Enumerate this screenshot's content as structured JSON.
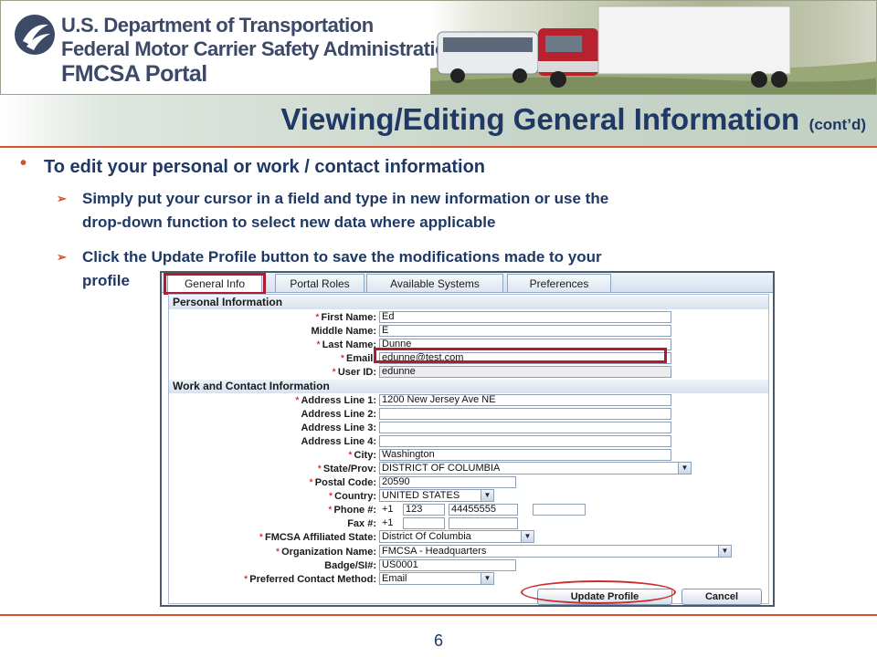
{
  "banner": {
    "dept": "U.S. Department of Transportation",
    "agency": "Federal Motor Carrier Safety Administration",
    "portal": "FMCSA Portal"
  },
  "slide": {
    "title": "Viewing/Editing General Information",
    "title_suffix": "(cont’d)",
    "bullet": "To edit your personal or work / contact information",
    "sub1_line1": "Simply put your cursor in a field and type in new information or use the",
    "sub1_line2": "drop-down function to select new data where applicable",
    "sub2_line1": "Click the Update Profile button to save the modifications made to your",
    "sub2_line2": "profile",
    "page_number": "6"
  },
  "tabs": [
    "General Info",
    "Portal Roles",
    "Available Systems",
    "Preferences"
  ],
  "sections": {
    "personal": "Personal Information",
    "work": "Work and Contact Information"
  },
  "labels": {
    "first_name": "First Name:",
    "middle_name": "Middle Name:",
    "last_name": "Last Name:",
    "email": "Email:",
    "user_id": "User ID:",
    "address1": "Address Line 1:",
    "address2": "Address Line 2:",
    "address3": "Address Line 3:",
    "address4": "Address Line 4:",
    "city": "City:",
    "state": "State/Prov:",
    "postal": "Postal Code:",
    "country": "Country:",
    "phone": "Phone #:",
    "fax": "Fax #:",
    "affiliated_state": "FMCSA Affiliated State:",
    "org": "Organization Name:",
    "badge": "Badge/SI#:",
    "contact_method": "Preferred Contact Method:"
  },
  "values": {
    "first_name": "Ed",
    "middle_name": "E",
    "last_name": "Dunne",
    "email": "edunne@test.com",
    "user_id": "edunne",
    "address1": "1200 New Jersey Ave NE",
    "address2": "",
    "address3": "",
    "address4": "",
    "city": "Washington",
    "state": "DISTRICT OF COLUMBIA",
    "postal": "20590",
    "country": "UNITED STATES",
    "phone_prefix": "+1",
    "phone_area": "123",
    "phone_number": "44455555",
    "phone_ext": "",
    "fax_prefix": "+1",
    "fax_area": "",
    "fax_number": "",
    "affiliated_state": "District Of Columbia",
    "org": "FMCSA - Headquarters",
    "badge": "US0001",
    "contact_method": "Email"
  },
  "buttons": {
    "update": "Update Profile",
    "cancel": "Cancel"
  },
  "colors": {
    "accent": "#d4522a",
    "title": "#1f3864",
    "highlight": "#b01c2e"
  }
}
